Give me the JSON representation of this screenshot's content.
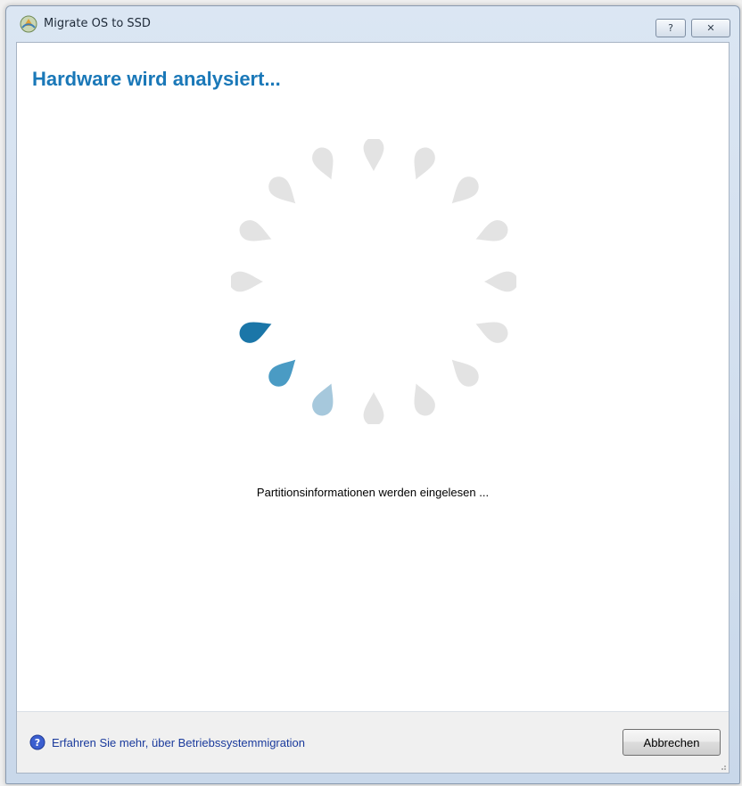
{
  "window": {
    "title": "Migrate OS to SSD",
    "help_button": "?",
    "close_button": "✕"
  },
  "main": {
    "heading": "Hardware wird analysiert...",
    "status_text": "Partitionsinformationen werden eingelesen ..."
  },
  "spinner": {
    "segments": 16,
    "active_index": 11,
    "colors": {
      "idle": "#e3e3e3",
      "active_1": "#1b76a8",
      "active_2": "#4a9bc4",
      "active_3": "#a6c8dc"
    }
  },
  "footer": {
    "help_link": "Erfahren Sie mehr, über Betriebssystemmigration",
    "cancel_button": "Abbrechen"
  },
  "colors": {
    "heading": "#1a78b8",
    "link": "#1a3a9c"
  }
}
